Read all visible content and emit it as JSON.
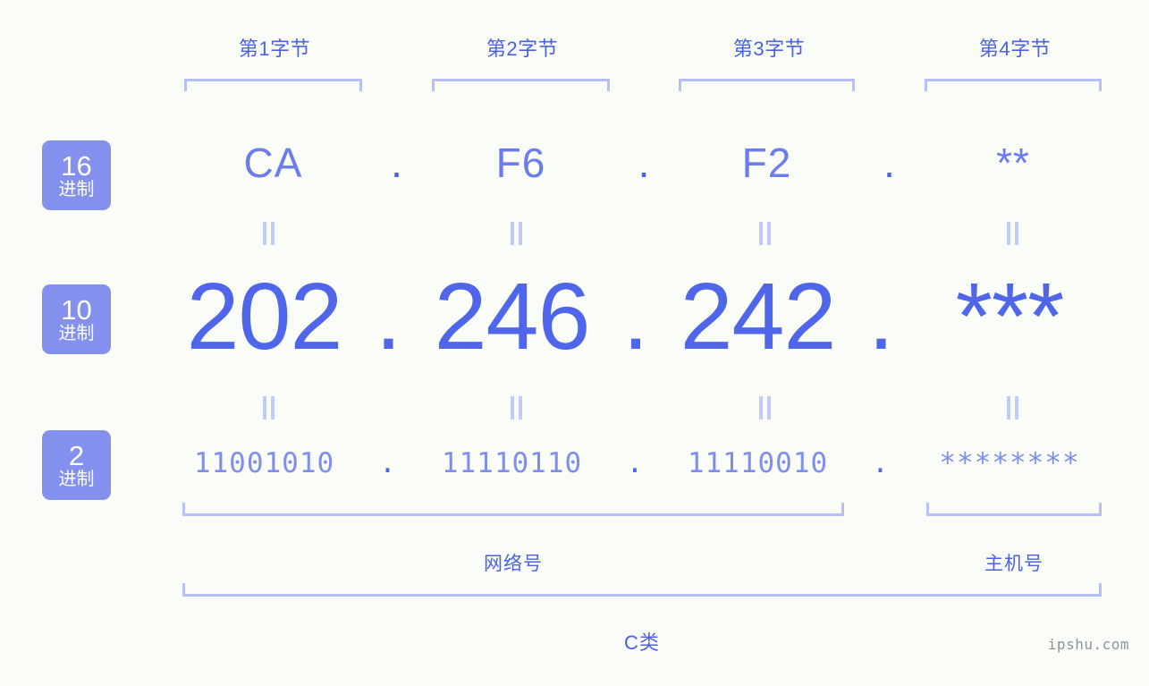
{
  "watermark": "ipshu.com",
  "byte_headers": [
    {
      "label": "第1字节"
    },
    {
      "label": "第2字节"
    },
    {
      "label": "第3字节"
    },
    {
      "label": "第4字节"
    }
  ],
  "rows": [
    {
      "badge_num": "16",
      "badge_cn": "进制",
      "values": [
        "CA",
        "F6",
        "F2",
        "**"
      ],
      "separator": "."
    },
    {
      "badge_num": "10",
      "badge_cn": "进制",
      "values": [
        "202",
        "246",
        "242",
        "***"
      ],
      "separator": "."
    },
    {
      "badge_num": "2",
      "badge_cn": "进制",
      "values": [
        "11001010",
        "11110110",
        "11110010",
        "********"
      ],
      "separator": "."
    }
  ],
  "equals_symbol": "=",
  "footer": {
    "network_label": "网络号",
    "host_label": "主机号",
    "class_label": "C类"
  },
  "colors": {
    "background": "#fafcf8",
    "badge_bg": "#8490ee",
    "accent_strong": "#4a61e8",
    "accent_mid": "#6b7ced",
    "accent_light": "#b7c0f4",
    "watermark": "#8f9499"
  }
}
